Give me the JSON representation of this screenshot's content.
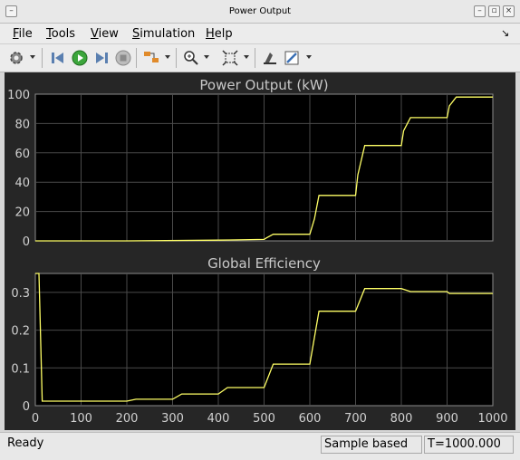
{
  "window": {
    "title": "Power Output"
  },
  "menubar": {
    "items": [
      "File",
      "Tools",
      "View",
      "Simulation",
      "Help"
    ]
  },
  "toolbar": {
    "icons": [
      "gear-icon",
      "step-back-icon",
      "run-icon",
      "step-forward-icon",
      "stop-icon",
      "signal-selector-icon",
      "zoom-icon",
      "fit-to-view-icon",
      "highlight-block-icon",
      "style-icon"
    ]
  },
  "plots": [
    {
      "title": "Power Output (kW)",
      "yticks": [
        "0",
        "20",
        "40",
        "60",
        "80",
        "100"
      ],
      "ylim": [
        0,
        100
      ],
      "xlim": [
        0,
        1000
      ]
    },
    {
      "title": "Global Efficiency",
      "yticks": [
        "0",
        "0.1",
        "0.2",
        "0.3"
      ],
      "ylim": [
        0,
        0.35
      ],
      "xlim": [
        0,
        1000
      ],
      "xticks": [
        "0",
        "100",
        "200",
        "300",
        "400",
        "500",
        "600",
        "700",
        "800",
        "900",
        "1000"
      ]
    }
  ],
  "chart_data": [
    {
      "type": "line",
      "title": "Power Output (kW)",
      "xlim": [
        0,
        1000
      ],
      "ylim": [
        0,
        100
      ],
      "grid": true,
      "line_color": "#ffff66",
      "background": "#000000",
      "series": [
        {
          "x": [
            0,
            200,
            400,
            500,
            505,
            520,
            600,
            610,
            620,
            700,
            705,
            720,
            800,
            805,
            820,
            900,
            905,
            920,
            1000
          ],
          "y": [
            0,
            0,
            0.5,
            1,
            2,
            4.5,
            4.5,
            15,
            31,
            31,
            45,
            65,
            65,
            75,
            84,
            84,
            92,
            98,
            98
          ]
        }
      ]
    },
    {
      "type": "line",
      "title": "Global Efficiency",
      "xlim": [
        0,
        1000
      ],
      "ylim": [
        0,
        0.35
      ],
      "grid": true,
      "line_color": "#ffff66",
      "background": "#000000",
      "series": [
        {
          "x": [
            0,
            4,
            8,
            15,
            200,
            220,
            300,
            320,
            400,
            420,
            500,
            520,
            600,
            620,
            700,
            720,
            800,
            820,
            900,
            905,
            1000
          ],
          "y": [
            0.35,
            0.35,
            0.35,
            0.012,
            0.012,
            0.017,
            0.017,
            0.031,
            0.031,
            0.048,
            0.048,
            0.11,
            0.11,
            0.25,
            0.25,
            0.31,
            0.31,
            0.302,
            0.302,
            0.297,
            0.297
          ]
        }
      ]
    }
  ],
  "status": {
    "left": "Ready",
    "mode": "Sample based",
    "time": "T=1000.000"
  }
}
